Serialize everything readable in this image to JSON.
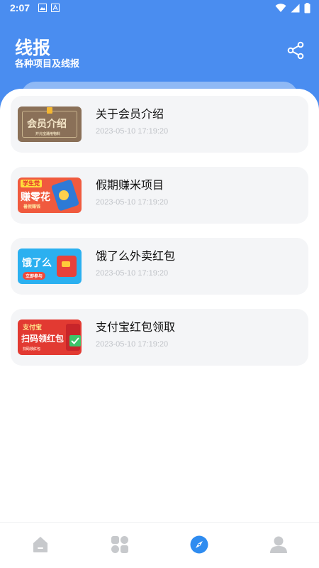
{
  "status_bar": {
    "time": "2:07"
  },
  "header": {
    "title": "线报",
    "subtitle": "各种项目及线报",
    "share_icon": "share-icon"
  },
  "colors": {
    "primary": "#4a8df0",
    "card_bg": "#f4f5f7",
    "date_text": "#c0c3c8",
    "nav_active": "#2f8cf0",
    "nav_inactive": "#c7c9cc"
  },
  "items": [
    {
      "title": "关于会员介绍",
      "date": "2023-05-10 17:19:20",
      "thumb": {
        "text": "会员介绍",
        "sub": "开元宝通用物料"
      }
    },
    {
      "title": "假期赚米项目",
      "date": "2023-05-10 17:19:20",
      "thumb": {
        "tag": "学生党",
        "text": "赚零花",
        "sub": "暑假赚钱"
      }
    },
    {
      "title": "饿了么外卖红包",
      "date": "2023-05-10 17:19:20",
      "thumb": {
        "text": "饿了么",
        "sub": "立即参与"
      }
    },
    {
      "title": "支付宝红包领取",
      "date": "2023-05-10 17:19:20",
      "thumb": {
        "tag": "支付宝",
        "text": "扫码领红包",
        "sub": "扫码领红包"
      }
    }
  ],
  "nav": [
    {
      "name": "home",
      "icon": "home-icon",
      "active": false
    },
    {
      "name": "apps",
      "icon": "grid-icon",
      "active": false
    },
    {
      "name": "discover",
      "icon": "compass-icon",
      "active": true
    },
    {
      "name": "profile",
      "icon": "user-icon",
      "active": false
    }
  ]
}
